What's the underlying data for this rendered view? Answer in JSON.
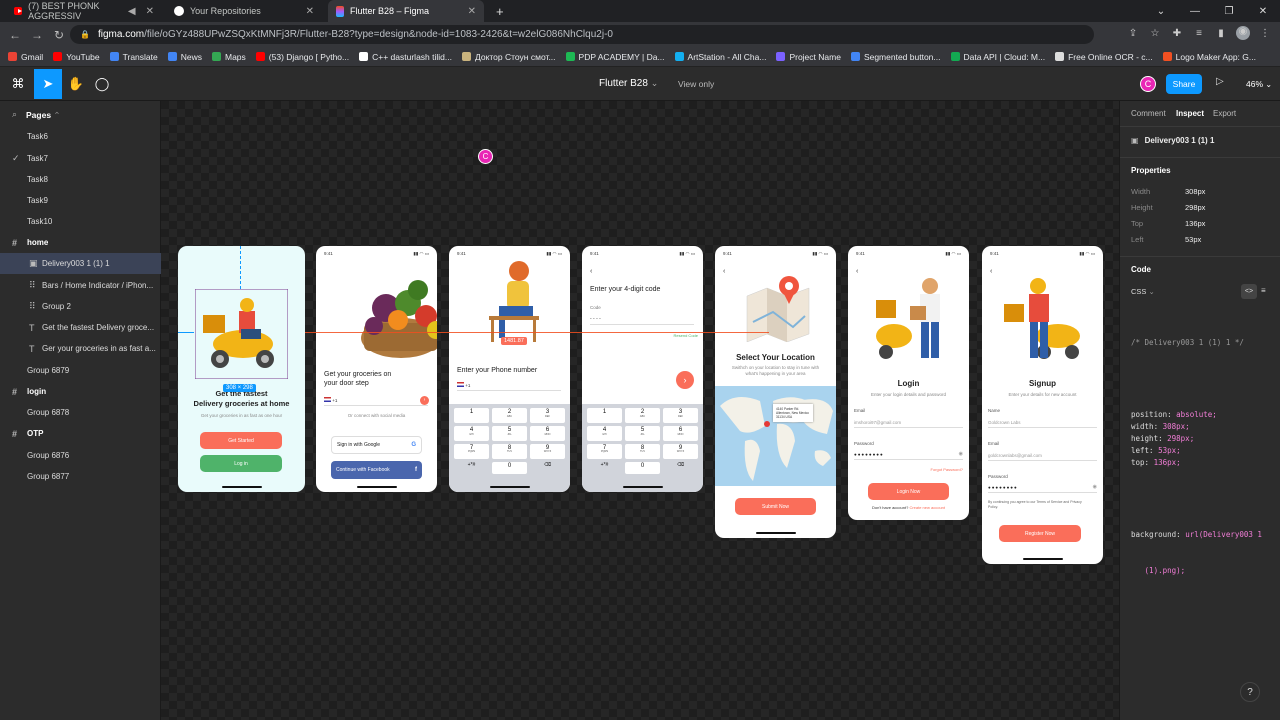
{
  "browser": {
    "tabs": [
      {
        "title": "(7) BEST PHONK AGGRESSIV",
        "icon": "youtube-icon"
      },
      {
        "title": "Your Repositories",
        "icon": "github-icon"
      },
      {
        "title": "Flutter B28 – Figma",
        "icon": "figma-icon"
      }
    ],
    "url_host": "figma.com",
    "url_rest": "/file/oGYz488UPwZSQxKtMNFj3R/Flutter-B28?type=design&node-id=1083-2426&t=w2elG086NhClqu2j-0",
    "bookmarks": [
      {
        "label": "Gmail",
        "color": "#ea4335"
      },
      {
        "label": "YouTube",
        "color": "#ff0000"
      },
      {
        "label": "Translate",
        "color": "#4285f4"
      },
      {
        "label": "News",
        "color": "#4285f4"
      },
      {
        "label": "Maps",
        "color": "#34a853"
      },
      {
        "label": "(53) Django [ Pytho...",
        "color": "#ff0000"
      },
      {
        "label": "C++ dasturlash tilid...",
        "color": "#ffffff"
      },
      {
        "label": "Доктор Стоун смот...",
        "color": "#c9b37e"
      },
      {
        "label": "PDP ACADEMY | Da...",
        "color": "#1db954"
      },
      {
        "label": "ArtStation - All Cha...",
        "color": "#13aff0"
      },
      {
        "label": "Project Name",
        "color": "#7b61ff"
      },
      {
        "label": "Segmented button...",
        "color": "#4285f4"
      },
      {
        "label": "Data API | Cloud: M...",
        "color": "#13aa52"
      },
      {
        "label": "Free Online OCR - c...",
        "color": "#dddddd"
      },
      {
        "label": "Logo Maker App: G...",
        "color": "#f25022"
      }
    ]
  },
  "figma": {
    "file_name": "Flutter B28",
    "file_chevron": "⌄",
    "view_only": "View only",
    "avatar": "C",
    "share": "Share",
    "zoom": "46%"
  },
  "left_panel": {
    "pages_label": "Pages",
    "rows": [
      {
        "label": "Task6",
        "icon": "",
        "type": "page"
      },
      {
        "label": "Task7",
        "icon": "✓",
        "type": "page"
      },
      {
        "label": "Task8",
        "icon": "",
        "type": "page"
      },
      {
        "label": "Task9",
        "icon": "",
        "type": "page"
      },
      {
        "label": "Task10",
        "icon": "",
        "type": "page"
      },
      {
        "label": "home",
        "icon": "#",
        "type": "frame"
      },
      {
        "label": "Delivery003 1 (1) 1",
        "icon": "▣",
        "type": "layer-selected"
      },
      {
        "label": "Bars / Home Indicator / iPhon...",
        "icon": "⠿",
        "type": "layer"
      },
      {
        "label": "Group 2",
        "icon": "⠿",
        "type": "layer"
      },
      {
        "label": "Get the fastest Delivery groce...",
        "icon": "T",
        "type": "layer"
      },
      {
        "label": "Ger your groceries in as fast a...",
        "icon": "T",
        "type": "layer"
      },
      {
        "label": "Group 6879",
        "icon": "",
        "type": "group"
      },
      {
        "label": "login",
        "icon": "#",
        "type": "frame"
      },
      {
        "label": "Group 6878",
        "icon": "",
        "type": "group"
      },
      {
        "label": "OTP",
        "icon": "#",
        "type": "frame"
      },
      {
        "label": "Group 6876",
        "icon": "",
        "type": "group"
      },
      {
        "label": "Group 6877",
        "icon": "",
        "type": "group"
      }
    ]
  },
  "canvas": {
    "cursor_label": "C",
    "size_badge": "308 × 298",
    "screens": {
      "home": {
        "title": "Get the fastest Delivery groceries at home",
        "title_line1": "Get the fastest",
        "title_line2": "Delivery groceries at home",
        "subtitle": "Get your groceries in as fast as one hour",
        "btn_start": "Get Started",
        "btn_login": "Log in"
      },
      "social": {
        "time": "9:41",
        "title": "Get your groceries on your door step",
        "title_line1": "Get your groceries on",
        "title_line2": "your door step",
        "code": "+1",
        "or": "Or connect with social media",
        "google": "Sign in with Google",
        "facebook": "Continue with Facebook"
      },
      "phone": {
        "time": "9:41",
        "price": "1481.87",
        "title": "Enter your Phone number",
        "code": "+1"
      },
      "otp": {
        "time": "9:41",
        "title": "Enter your 4-digit code",
        "code_label": "Code",
        "code_value": "- - - -",
        "resend": "Resend Code"
      },
      "location": {
        "time": "9:41",
        "title": "Select Your Location",
        "subtitle": "Swithch on your location to stay in tune with what's happening in your area",
        "address": "4140 Parker Rd. Allentown, New Mexico 31134 USA",
        "btn": "Submit Now"
      },
      "login": {
        "time": "9:41",
        "title": "Login",
        "subtitle": "Enter your login details and password",
        "email_label": "Email",
        "email_value": "imshoroi97@gmail.com",
        "password_label": "Password",
        "password_value": "●●●●●●●●",
        "forgot": "Forgot Password?",
        "btn": "Login Now",
        "no_account": "Don't have account?",
        "create": "Create new account"
      },
      "signup": {
        "time": "9:41",
        "title": "Signup",
        "subtitle": "Enter your details for new account",
        "name_label": "Name",
        "name_value": "Goldcrown Labs",
        "email_label": "Email",
        "email_value": "goldcrownlabs@gmail.com",
        "password_label": "Password",
        "password_value": "●●●●●●●●",
        "terms": "By continuing you agree to our Terms of Service and Privacy Policy.",
        "btn": "Register Now"
      },
      "keypad": [
        {
          "d": "1",
          "l": ""
        },
        {
          "d": "2",
          "l": "ABC"
        },
        {
          "d": "3",
          "l": "DEF"
        },
        {
          "d": "4",
          "l": "GHI"
        },
        {
          "d": "5",
          "l": "JKL"
        },
        {
          "d": "6",
          "l": "MNO"
        },
        {
          "d": "7",
          "l": "PQRS"
        },
        {
          "d": "8",
          "l": "TUV"
        },
        {
          "d": "9",
          "l": "WXYZ"
        },
        {
          "d": "+*#",
          "l": ""
        },
        {
          "d": "0",
          "l": ""
        },
        {
          "d": "⌫",
          "l": ""
        }
      ]
    }
  },
  "right_panel": {
    "tabs": [
      "Comment",
      "Inspect",
      "Export"
    ],
    "layer_name": "Delivery003 1 (1) 1",
    "properties_title": "Properties",
    "properties": [
      {
        "label": "Width",
        "value": "308px"
      },
      {
        "label": "Height",
        "value": "298px"
      },
      {
        "label": "Top",
        "value": "136px"
      },
      {
        "label": "Left",
        "value": "53px"
      }
    ],
    "code_title": "Code",
    "code_lang": "CSS",
    "code_comment": "/* Delivery003 1 (1) 1 */",
    "code_lines": [
      {
        "k": "position: ",
        "v": "absolute;"
      },
      {
        "k": "width: ",
        "v": "308px;"
      },
      {
        "k": "height: ",
        "v": "298px;"
      },
      {
        "k": "left: ",
        "v": "53px;"
      },
      {
        "k": "top: ",
        "v": "136px;"
      }
    ],
    "code_bg_k": "background: ",
    "code_bg_v": "url(Delivery003 1",
    "code_bg_v2": "(1).png);",
    "help": "?"
  },
  "colors": {
    "accent": "#0d99ff",
    "orange": "#fa6e5a",
    "green": "#4fb36a",
    "cursor": "#e927b5"
  }
}
